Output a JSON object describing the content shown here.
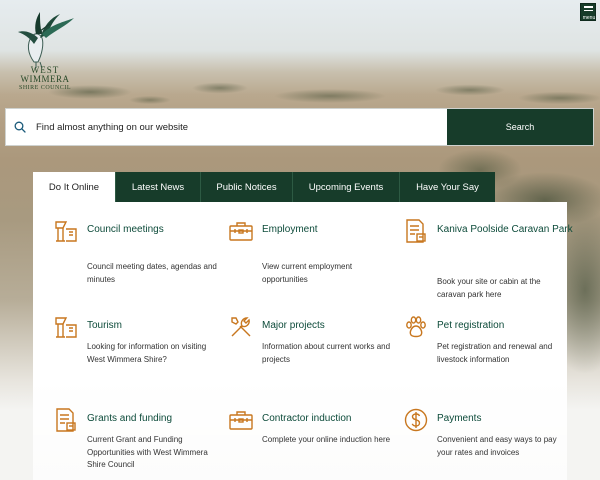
{
  "logo": {
    "line1": "WEST",
    "line2": "WIMMERA",
    "line3": "SHIRE COUNCIL"
  },
  "menu": {
    "label": "menu"
  },
  "search": {
    "placeholder": "Find almost anything on our website",
    "button_label": "Search"
  },
  "tabs": [
    {
      "label": "Do It Online",
      "active": true
    },
    {
      "label": "Latest News"
    },
    {
      "label": "Public Notices"
    },
    {
      "label": "Upcoming Events"
    },
    {
      "label": "Have Your Say"
    }
  ],
  "accent_colors": {
    "brand_green": "#173c2a",
    "icon_orange": "#c8771f",
    "link_green": "#0d4b3a"
  },
  "tiles": [
    {
      "title": "Council meetings",
      "desc": "Council meeting dates, agendas and minutes",
      "icon": "podium-icon"
    },
    {
      "title": "Employment",
      "desc": "View current employment opportunities",
      "icon": "toolbox-icon"
    },
    {
      "title": "Kaniva Poolside Caravan Park",
      "desc": "Book your site or cabin at the caravan park here",
      "icon": "booking-form-icon"
    },
    {
      "title": "Tourism",
      "desc": "Looking for information on visiting West Wimmera Shire?",
      "icon": "podium-icon"
    },
    {
      "title": "Major projects",
      "desc": "Information about current works and projects",
      "icon": "tools-icon"
    },
    {
      "title": "Pet registration",
      "desc": "Pet registration and renewal and livestock information",
      "icon": "paw-icon"
    },
    {
      "title": "Grants and funding",
      "desc": "Current Grant and Funding Opportunities with West Wimmera Shire Council",
      "icon": "form-icon"
    },
    {
      "title": "Contractor induction",
      "desc": "Complete your online induction here",
      "icon": "toolbox-icon"
    },
    {
      "title": "Payments",
      "desc": "Convenient and easy ways to pay your rates and invoices",
      "icon": "dollar-icon"
    }
  ]
}
